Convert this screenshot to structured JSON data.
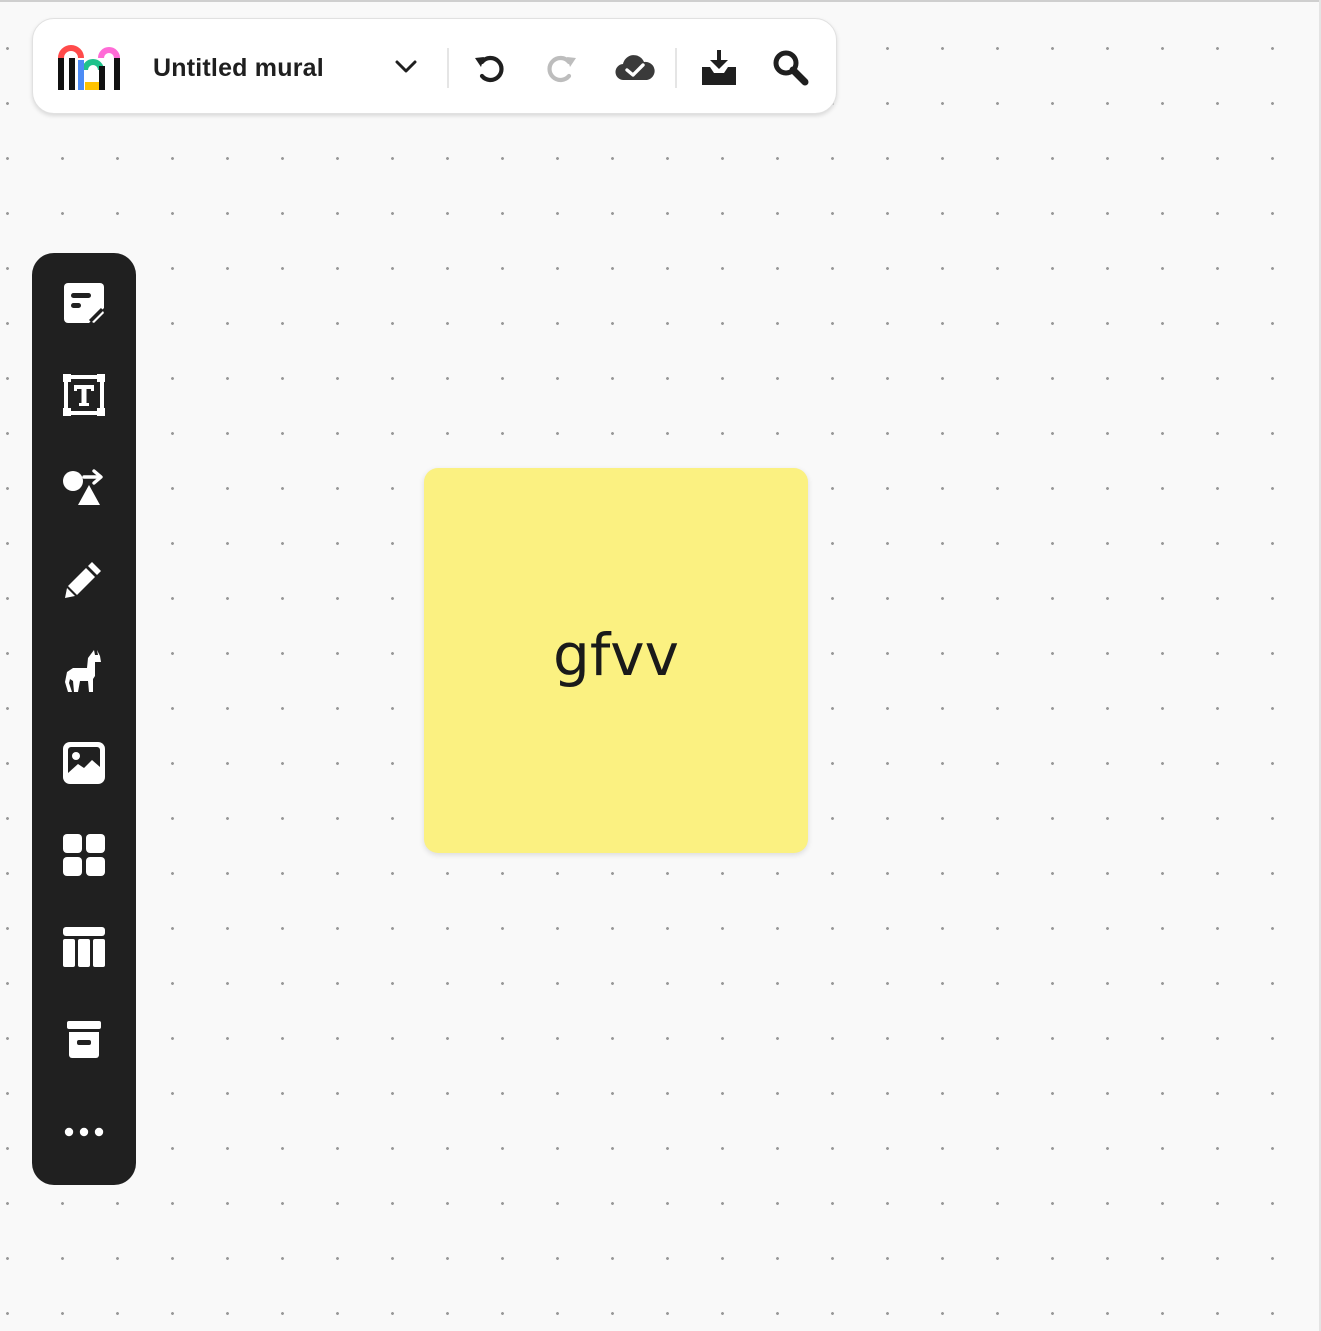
{
  "topbar": {
    "mural_title": "Untitled mural",
    "icons": [
      "mural-logo-icon",
      "chevron-down-icon",
      "undo-icon",
      "redo-icon",
      "cloud-saved-icon",
      "export-download-icon",
      "search-icon"
    ]
  },
  "toolbar": {
    "tools": [
      {
        "name": "sticky-note",
        "icon": "sticky-note-icon"
      },
      {
        "name": "text",
        "icon": "text-box-icon"
      },
      {
        "name": "shapes-connectors",
        "icon": "shapes-arrow-icon"
      },
      {
        "name": "draw",
        "icon": "pencil-icon"
      },
      {
        "name": "icons",
        "icon": "llama-icon"
      },
      {
        "name": "image",
        "icon": "image-icon"
      },
      {
        "name": "templates",
        "icon": "grid-icon"
      },
      {
        "name": "table",
        "icon": "table-icon"
      },
      {
        "name": "archive",
        "icon": "archive-icon"
      },
      {
        "name": "more",
        "icon": "more-dots-icon"
      }
    ]
  },
  "canvas": {
    "sticky_note": {
      "text": "gfvv",
      "color": "#fbf181"
    }
  },
  "colors": {
    "toolbar_bg": "#202020",
    "canvas_bg": "#f9f9f9",
    "logo_red": "#ff4b4b",
    "logo_blue": "#4c8bf5",
    "logo_green": "#1ec28b",
    "logo_pink": "#ff6bd6",
    "logo_yellow": "#ffc200"
  }
}
